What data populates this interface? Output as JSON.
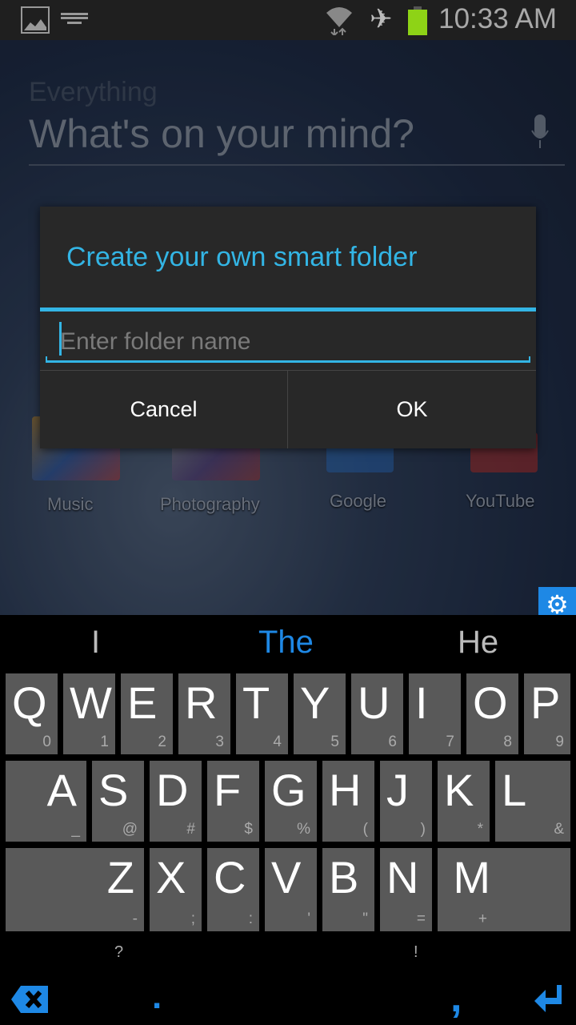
{
  "status_bar": {
    "time": "10:33 AM",
    "icons": [
      "gallery-notification-icon",
      "keyboard-notification-icon",
      "wifi-icon",
      "airplane-mode-icon",
      "battery-icon"
    ],
    "battery_color": "#8ed316"
  },
  "search_widget": {
    "hint": "Everything",
    "prompt": "What's on your mind?",
    "icon": "microphone-icon"
  },
  "apps": [
    {
      "label": "Music"
    },
    {
      "label": "Photography"
    },
    {
      "label": "Google"
    },
    {
      "label": "YouTube"
    }
  ],
  "dialog": {
    "title": "Create your own smart folder",
    "input_placeholder": "Enter folder name",
    "input_value": "",
    "cancel_label": "Cancel",
    "ok_label": "OK",
    "accent": "#33b5e5"
  },
  "keyboard": {
    "settings_icon": "gear-icon",
    "suggestions": [
      "I",
      "The",
      "He"
    ],
    "rows": [
      [
        {
          "k": "Q",
          "s": "0"
        },
        {
          "k": "W",
          "s": "1"
        },
        {
          "k": "E",
          "s": "2"
        },
        {
          "k": "R",
          "s": "3"
        },
        {
          "k": "T",
          "s": "4"
        },
        {
          "k": "Y",
          "s": "5"
        },
        {
          "k": "U",
          "s": "6"
        },
        {
          "k": "I",
          "s": "7"
        },
        {
          "k": "O",
          "s": "8"
        },
        {
          "k": "P",
          "s": "9"
        }
      ],
      [
        {
          "k": "A",
          "s": "_"
        },
        {
          "k": "S",
          "s": "@"
        },
        {
          "k": "D",
          "s": "#"
        },
        {
          "k": "F",
          "s": "$"
        },
        {
          "k": "G",
          "s": "%"
        },
        {
          "k": "H",
          "s": "("
        },
        {
          "k": "J",
          "s": ")"
        },
        {
          "k": "K",
          "s": "*"
        },
        {
          "k": "L",
          "s": "&"
        }
      ],
      [
        {
          "k": "Z",
          "s": "-"
        },
        {
          "k": "X",
          "s": ";"
        },
        {
          "k": "C",
          "s": ":"
        },
        {
          "k": "V",
          "s": "'"
        },
        {
          "k": "B",
          "s": "\""
        },
        {
          "k": "N",
          "s": "="
        },
        {
          "k": "M",
          "s": "+"
        }
      ]
    ],
    "extra_hints": {
      "left": "?",
      "right": "!"
    },
    "bottom": {
      "period": ".",
      "comma": ","
    },
    "accent": "#1e88e5"
  }
}
